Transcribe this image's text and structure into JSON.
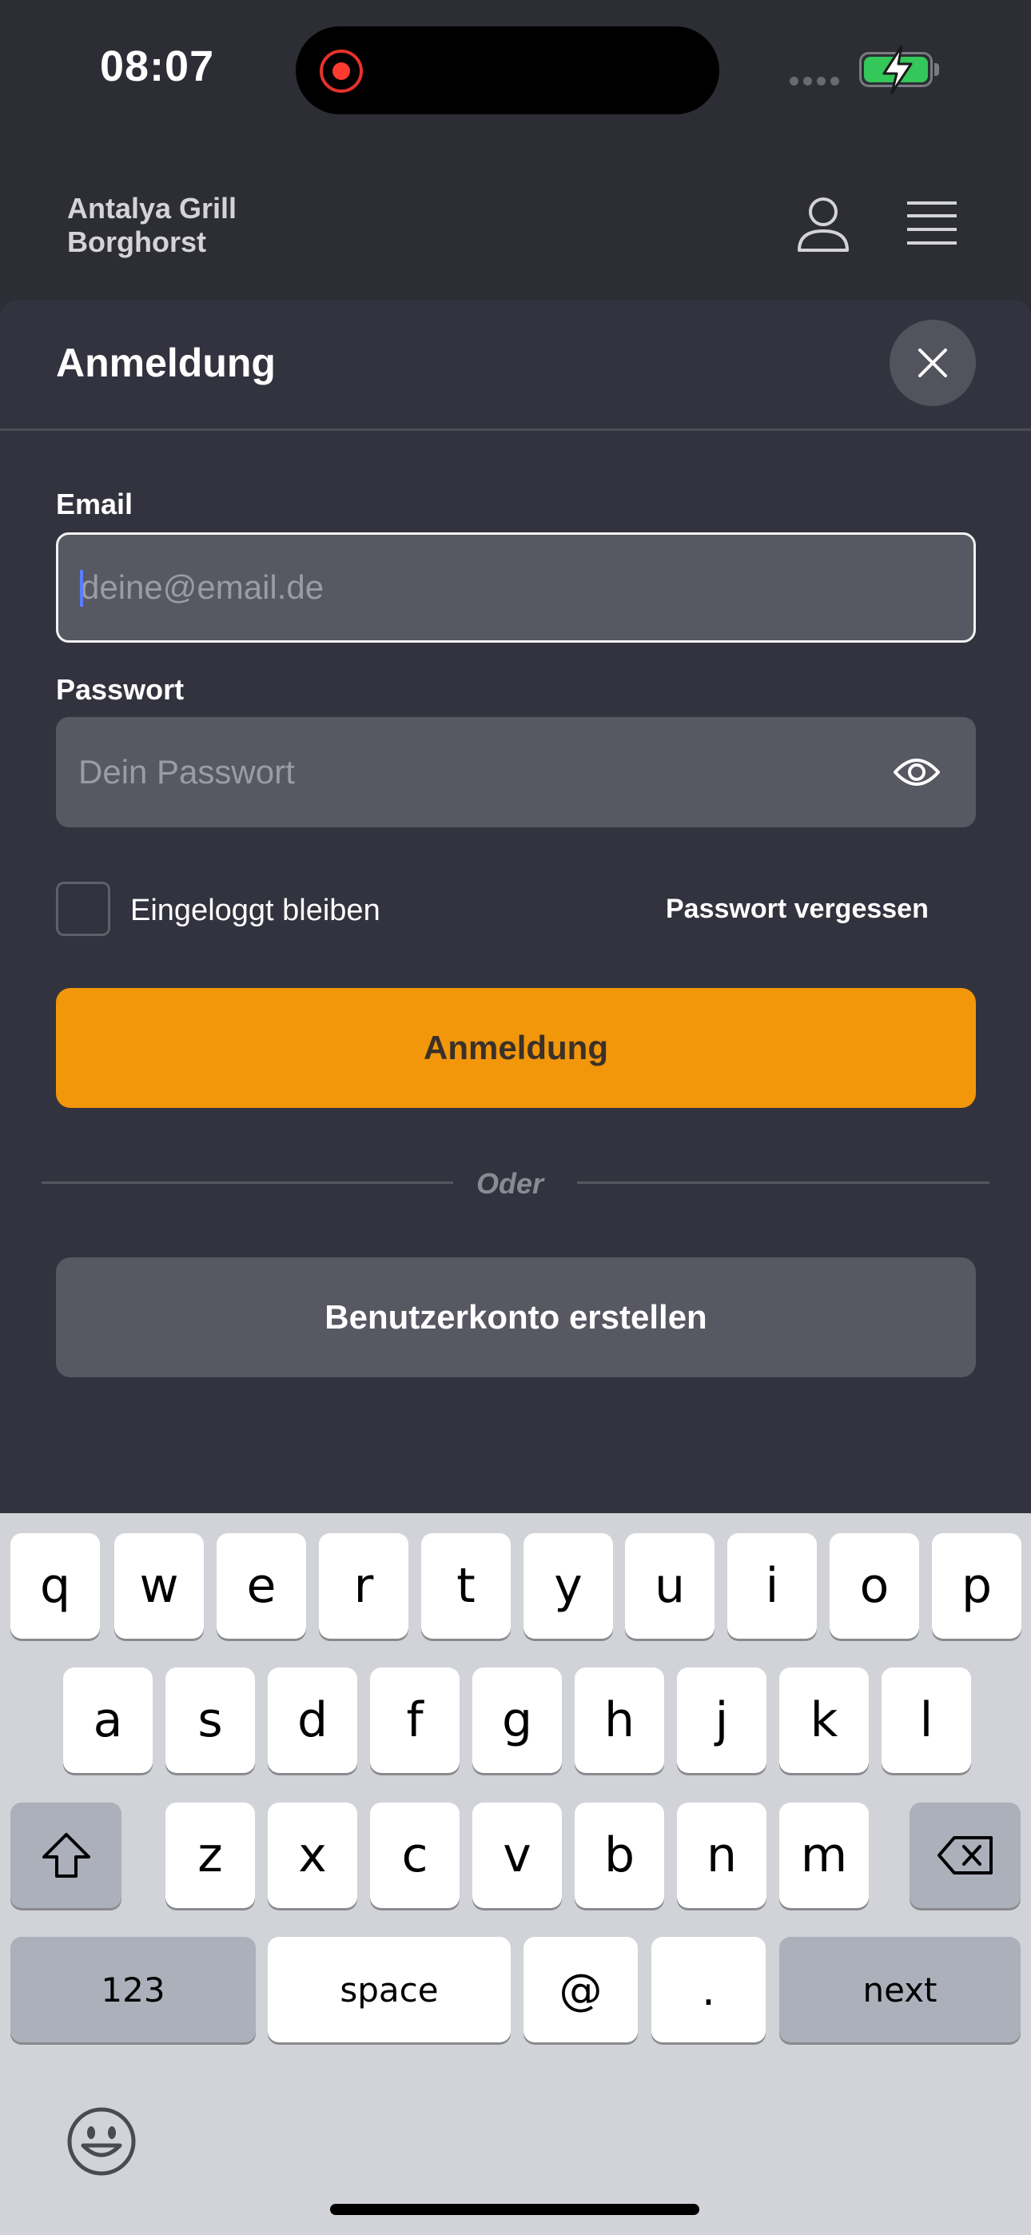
{
  "status_bar": {
    "time": "08:07"
  },
  "header": {
    "brand_line1": "Antalya Grill",
    "brand_line2": "Borghorst",
    "icons": [
      "user-icon",
      "menu-icon"
    ]
  },
  "modal": {
    "title": "Anmeldung",
    "close_icon": "close-icon",
    "email": {
      "label": "Email",
      "placeholder": "deine@email.de",
      "value": ""
    },
    "password": {
      "label": "Passwort",
      "placeholder": "Dein Passwort",
      "value": "",
      "toggle_icon": "eye-icon"
    },
    "remember_me": {
      "label": "Eingeloggt bleiben",
      "checked": false
    },
    "forgot_password": "Passwort vergessen",
    "login_button": "Anmeldung",
    "divider_text": "Oder",
    "register_button": "Benutzerkonto erstellen"
  },
  "keyboard": {
    "row1": [
      "q",
      "w",
      "e",
      "r",
      "t",
      "y",
      "u",
      "i",
      "o",
      "p"
    ],
    "row2": [
      "a",
      "s",
      "d",
      "f",
      "g",
      "h",
      "j",
      "k",
      "l"
    ],
    "row3": [
      "z",
      "x",
      "c",
      "v",
      "b",
      "n",
      "m"
    ],
    "numbers_key": "123",
    "space_key": "space",
    "at_key": "@",
    "dot_key": ".",
    "next_key": "next"
  },
  "colors": {
    "background": "#2c2d35",
    "modal": "#32333e",
    "accent": "#f2960a",
    "input": "#575862"
  }
}
